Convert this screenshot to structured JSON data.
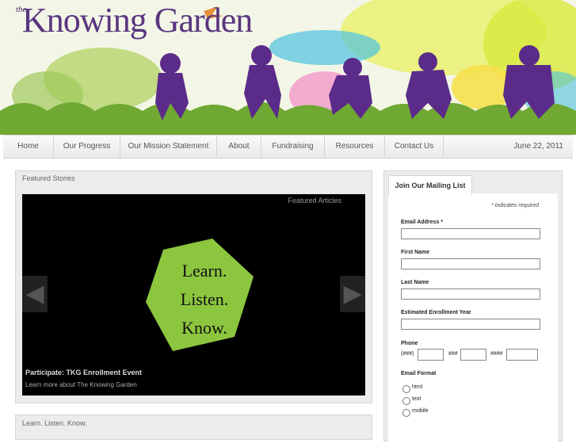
{
  "header": {
    "logo_small": "the",
    "logo_text": "Knowing Garden"
  },
  "nav": {
    "items": [
      {
        "label": "Home"
      },
      {
        "label": "Our Progress"
      },
      {
        "label": "Our Mission Statement"
      },
      {
        "label": "About"
      },
      {
        "label": "Fundraising"
      },
      {
        "label": "Resources"
      },
      {
        "label": "Contact Us"
      }
    ],
    "date": "June 22, 2011"
  },
  "featured": {
    "title": "Featured Stories",
    "slider_label": "Featured Articles",
    "slide_lines": [
      "Learn.",
      "Listen.",
      "Know."
    ],
    "caption_title": "Participate: TKG Enrollment Event",
    "caption_sub": "Learn more about The Knowing Garden"
  },
  "learn_panel": {
    "title": "Learn. Listen. Know."
  },
  "mailing": {
    "tab_label": "Join Our Mailing List",
    "required_note": "* indicates required",
    "email_label": "Email Address *",
    "first_name_label": "First Name",
    "last_name_label": "Last Name",
    "enrollment_label": "Estimated Enrollment Year",
    "phone_label": "Phone",
    "phone_parts": [
      "(###)",
      "###",
      "####"
    ],
    "format_label": "Email Format",
    "format_options": [
      "html",
      "text",
      "mobile"
    ]
  },
  "colors": {
    "brand_purple": "#5a3580",
    "hex_green": "#8cc63f"
  }
}
